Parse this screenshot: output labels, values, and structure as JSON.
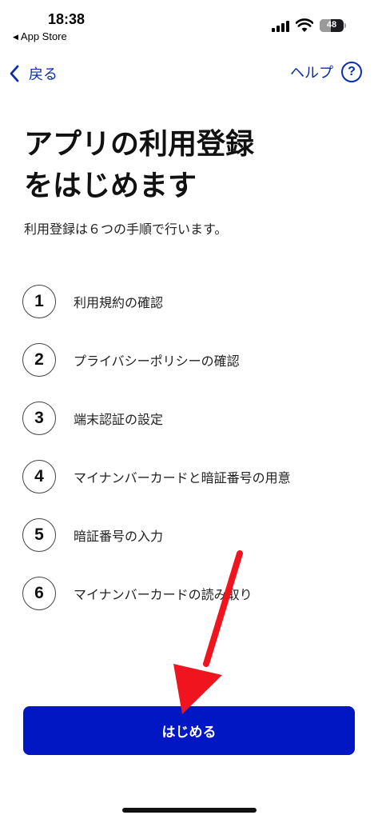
{
  "status_bar": {
    "time": "18:38",
    "back_app": "App Store",
    "battery_level": "48"
  },
  "nav": {
    "back_label": "戻る",
    "help_label": "ヘルプ",
    "help_icon_glyph": "?"
  },
  "main": {
    "title_line1": "アプリの利用登録",
    "title_line2": "をはじめます",
    "subtitle": "利用登録は６つの手順で行います。",
    "steps": [
      {
        "number": "1",
        "label": "利用規約の確認"
      },
      {
        "number": "2",
        "label": "プライバシーポリシーの確認"
      },
      {
        "number": "3",
        "label": "端末認証の設定"
      },
      {
        "number": "4",
        "label": "マイナンバーカードと暗証番号の用意"
      },
      {
        "number": "5",
        "label": "暗証番号の入力"
      },
      {
        "number": "6",
        "label": "マイナンバーカードの読み取り"
      }
    ]
  },
  "footer": {
    "start_button_label": "はじめる"
  },
  "colors": {
    "accent": "#0b2ea8",
    "button_bg": "#0017c3",
    "annotation_arrow": "#f0141e"
  },
  "icons": {
    "back": "chevron-left-icon",
    "help": "question-circle-icon",
    "signal": "cellular-signal-icon",
    "wifi": "wifi-icon",
    "battery": "battery-icon",
    "annotation": "red-arrow-icon"
  }
}
